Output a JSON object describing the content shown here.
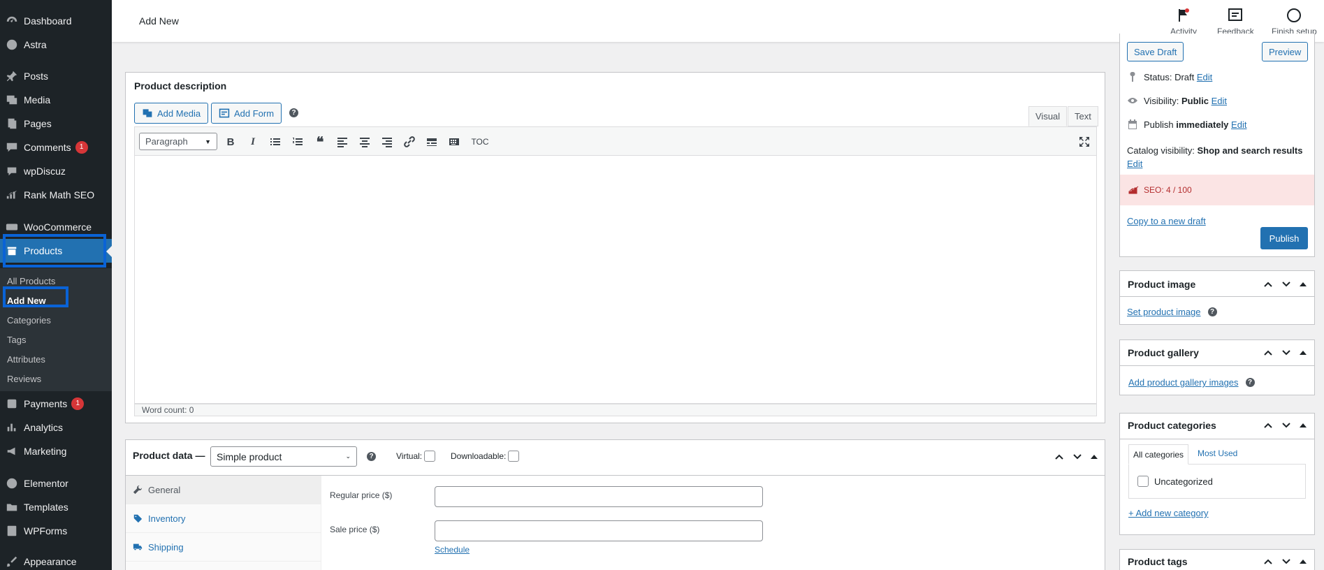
{
  "sidebar": {
    "items": [
      {
        "label": "Dashboard",
        "icon": "dashboard-icon"
      },
      {
        "label": "Astra",
        "icon": "astra-icon"
      },
      {
        "label": "Posts",
        "icon": "pin-icon"
      },
      {
        "label": "Media",
        "icon": "media-icon"
      },
      {
        "label": "Pages",
        "icon": "pages-icon"
      },
      {
        "label": "Comments",
        "icon": "comments-icon",
        "badge": "1"
      },
      {
        "label": "wpDiscuz",
        "icon": "discuz-icon"
      },
      {
        "label": "Rank Math SEO",
        "icon": "rankmath-icon"
      },
      {
        "label": "WooCommerce",
        "icon": "woocommerce-icon"
      },
      {
        "label": "Products",
        "icon": "products-icon"
      },
      {
        "label": "Payments",
        "icon": "payments-icon",
        "badge": "1"
      },
      {
        "label": "Analytics",
        "icon": "analytics-icon"
      },
      {
        "label": "Marketing",
        "icon": "megaphone-icon"
      },
      {
        "label": "Elementor",
        "icon": "elementor-icon"
      },
      {
        "label": "Templates",
        "icon": "folder-icon"
      },
      {
        "label": "WPForms",
        "icon": "wpforms-icon"
      },
      {
        "label": "Appearance",
        "icon": "brush-icon"
      }
    ],
    "submenu": [
      "All Products",
      "Add New",
      "Categories",
      "Tags",
      "Attributes",
      "Reviews"
    ]
  },
  "header": {
    "title": "Add New",
    "activity": "Activity",
    "feedback": "Feedback",
    "finish_setup": "Finish setup"
  },
  "description": {
    "title": "Product description",
    "add_media": "Add Media",
    "add_form": "Add Form",
    "tab_visual": "Visual",
    "tab_text": "Text",
    "format": "Paragraph",
    "toc": "TOC",
    "word_count": "Word count: 0"
  },
  "product_data": {
    "title": "Product data —",
    "type": "Simple product",
    "virtual": "Virtual:",
    "downloadable": "Downloadable:",
    "tabs": [
      "General",
      "Inventory",
      "Shipping"
    ],
    "regular_price": "Regular price ($)",
    "sale_price": "Sale price ($)",
    "schedule": "Schedule"
  },
  "publish": {
    "save_draft": "Save Draft",
    "preview": "Preview",
    "status_label": "Status:",
    "status_value": "Draft",
    "visibility_label": "Visibility:",
    "visibility_value": "Public",
    "publish_label": "Publish",
    "publish_value": "immediately",
    "edit": "Edit",
    "catalog_label": "Catalog visibility:",
    "catalog_value": "Shop and search results",
    "seo": "SEO: 4 / 100",
    "copy_draft": "Copy to a new draft",
    "publish_btn": "Publish"
  },
  "product_image": {
    "title": "Product image",
    "link": "Set product image"
  },
  "product_gallery": {
    "title": "Product gallery",
    "link": "Add product gallery images"
  },
  "product_categories": {
    "title": "Product categories",
    "tab_all": "All categories",
    "tab_used": "Most Used",
    "item": "Uncategorized",
    "add": "+ Add new category"
  },
  "product_tags": {
    "title": "Product tags"
  },
  "colors": {
    "accent": "#2271b1",
    "sidebar": "#1d2327",
    "highlight": "#0a63d6",
    "seo_bg": "#fbe4e4"
  }
}
